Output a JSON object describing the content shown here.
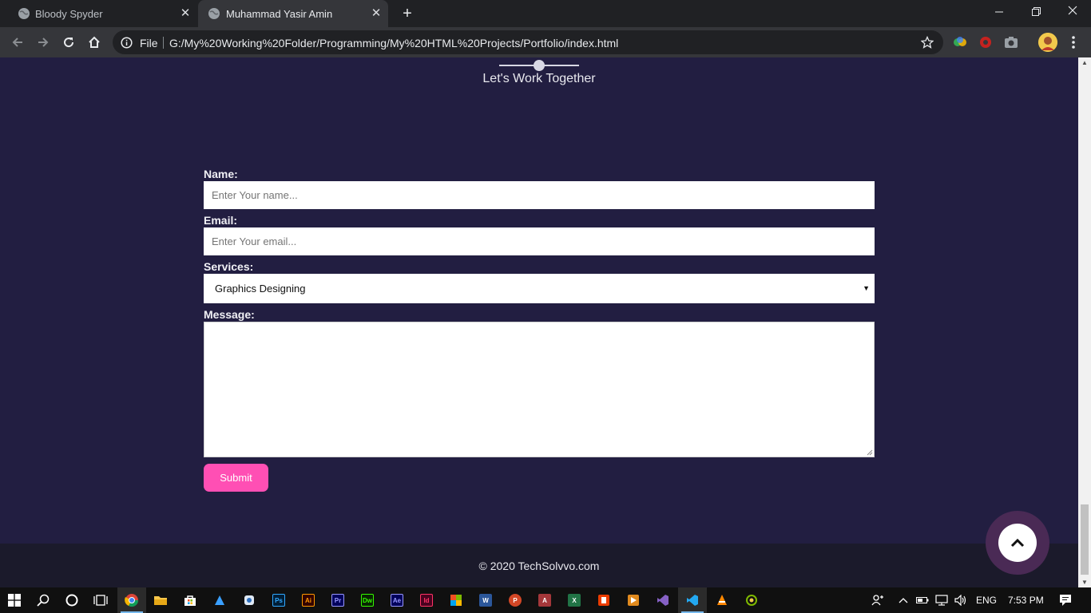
{
  "browser": {
    "tabs": [
      {
        "title": "Bloody Spyder",
        "active": false
      },
      {
        "title": "Muhammad Yasir Amin",
        "active": true
      }
    ],
    "address": {
      "scheme_label": "File",
      "url": "G:/My%20Working%20Folder/Programming/My%20HTML%20Projects/Portfolio/index.html"
    },
    "icons": [
      "back-icon",
      "forward-icon",
      "reload-icon",
      "home-icon",
      "info-icon",
      "star-icon",
      "menu-dots-icon"
    ]
  },
  "page": {
    "section_title": "Let's Work Together",
    "form": {
      "name_label": "Name:",
      "name_placeholder": "Enter Your name...",
      "email_label": "Email:",
      "email_placeholder": "Enter Your email...",
      "services_label": "Services:",
      "services_selected": "Graphics Designing",
      "message_label": "Message:",
      "submit_label": "Submit"
    },
    "footer_text": "© 2020 TechSolvvo.com",
    "colors": {
      "background": "#221e41",
      "footer": "#1b1a2b",
      "accent": "#ff4fb4"
    }
  },
  "taskbar": {
    "language": "ENG",
    "time": "7:53 PM",
    "apps": [
      {
        "name": "ps",
        "label": "Ps",
        "color": "#31a8ff"
      },
      {
        "name": "ai",
        "label": "Ai",
        "color": "#ff9a00"
      },
      {
        "name": "pr",
        "label": "Pr",
        "color": "#9999ff"
      },
      {
        "name": "dw",
        "label": "Dw",
        "color": "#35fa00"
      },
      {
        "name": "ae",
        "label": "Ae",
        "color": "#9999ff"
      },
      {
        "name": "id",
        "label": "Id",
        "color": "#ff3366"
      },
      {
        "name": "w",
        "label": "W",
        "color": "#2b579a"
      },
      {
        "name": "p",
        "label": "P",
        "color": "#d24726"
      },
      {
        "name": "a",
        "label": "A",
        "color": "#a4373a"
      },
      {
        "name": "x",
        "label": "X",
        "color": "#217346"
      }
    ]
  }
}
